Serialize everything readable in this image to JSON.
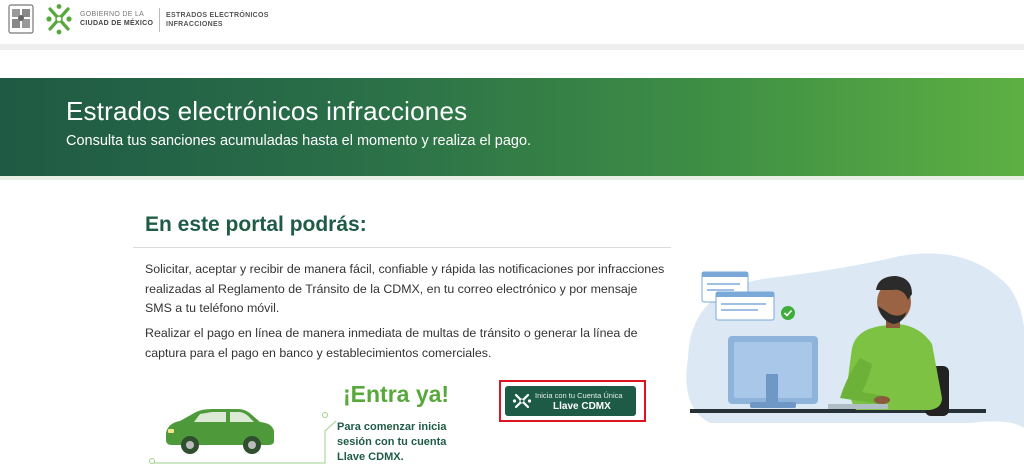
{
  "header": {
    "gov_line1": "GOBIERNO DE LA",
    "gov_line2": "CIUDAD DE MÉXICO",
    "section_line1": "ESTRADOS ELECTRÓNICOS",
    "section_line2": "INFRACCIONES"
  },
  "banner": {
    "title": "Estrados electrónicos infracciones",
    "subtitle": "Consulta tus sanciones acumuladas hasta el momento y realiza el pago."
  },
  "main": {
    "section_title": "En este portal podrás:",
    "paragraph1": "Solicitar, aceptar y recibir de manera fácil, confiable y rápida las notificaciones por infracciones realizadas al Reglamento de Tránsito de la CDMX, en tu correo electrónico y por mensaje SMS a tu teléfono móvil.",
    "paragraph2": "Realizar el pago en línea de manera inmediata de multas de tránsito o generar la línea de captura para el pago en banco y establecimientos comerciales.",
    "cta_heading": "¡Entra ya!",
    "cta_text": "Para comenzar inicia sesión con tu cuenta Llave CDMX.",
    "llave_button": {
      "line1": "Inicia con tu Cuenta Única",
      "line2": "Llave CDMX"
    }
  },
  "colors": {
    "brand_dark_green": "#1f5c45",
    "brand_light_green": "#5db042",
    "highlight_red": "#e0141e"
  },
  "icons": [
    "coat-of-arms-icon",
    "cdmx-logo-icon",
    "llave-logo-icon",
    "car-illustration",
    "person-at-computer-illustration"
  ]
}
